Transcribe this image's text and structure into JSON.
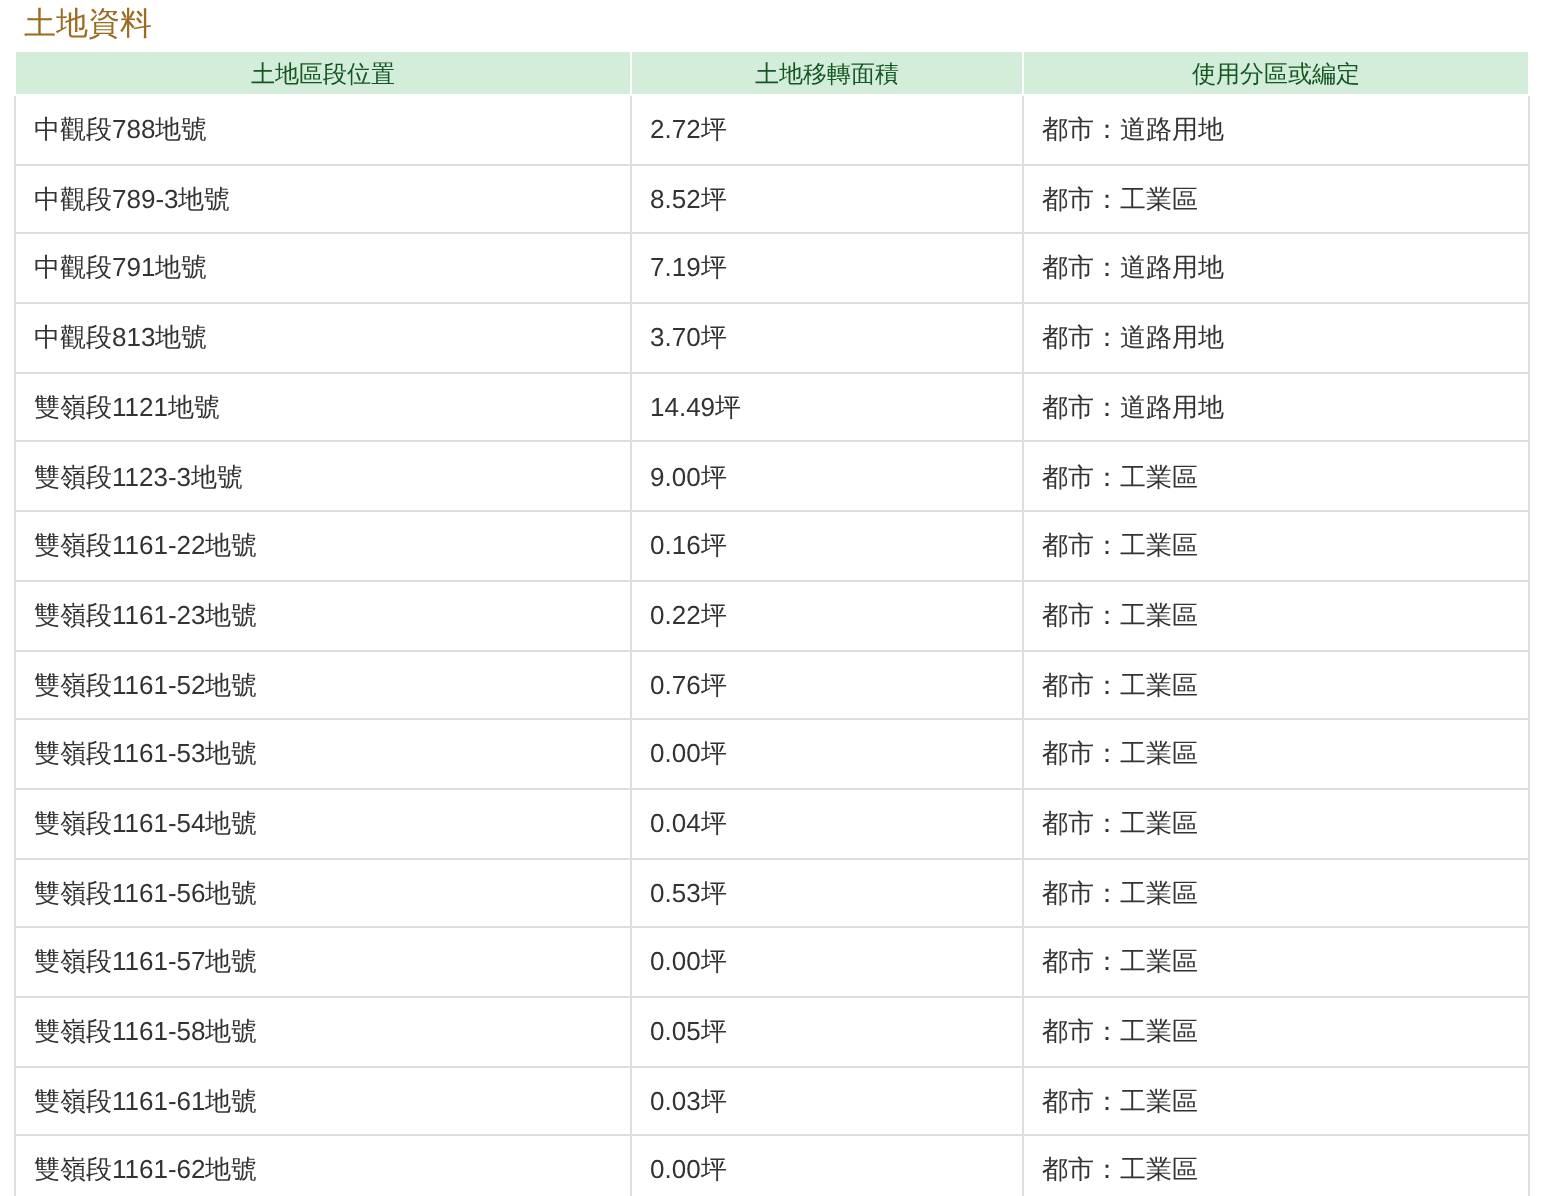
{
  "title": "土地資料",
  "table": {
    "columns": [
      "土地區段位置",
      "土地移轉面積",
      "使用分區或編定"
    ],
    "rows": [
      [
        "中觀段788地號",
        "2.72坪",
        "都市：道路用地"
      ],
      [
        "中觀段789-3地號",
        "8.52坪",
        "都市：工業區"
      ],
      [
        "中觀段791地號",
        "7.19坪",
        "都市：道路用地"
      ],
      [
        "中觀段813地號",
        "3.70坪",
        "都市：道路用地"
      ],
      [
        "雙嶺段1121地號",
        "14.49坪",
        "都市：道路用地"
      ],
      [
        "雙嶺段1123-3地號",
        "9.00坪",
        "都市：工業區"
      ],
      [
        "雙嶺段1161-22地號",
        "0.16坪",
        "都市：工業區"
      ],
      [
        "雙嶺段1161-23地號",
        "0.22坪",
        "都市：工業區"
      ],
      [
        "雙嶺段1161-52地號",
        "0.76坪",
        "都市：工業區"
      ],
      [
        "雙嶺段1161-53地號",
        "0.00坪",
        "都市：工業區"
      ],
      [
        "雙嶺段1161-54地號",
        "0.04坪",
        "都市：工業區"
      ],
      [
        "雙嶺段1161-56地號",
        "0.53坪",
        "都市：工業區"
      ],
      [
        "雙嶺段1161-57地號",
        "0.00坪",
        "都市：工業區"
      ],
      [
        "雙嶺段1161-58地號",
        "0.05坪",
        "都市：工業區"
      ],
      [
        "雙嶺段1161-61地號",
        "0.03坪",
        "都市：工業區"
      ],
      [
        "雙嶺段1161-62地號",
        "0.00坪",
        "都市：工業區"
      ]
    ]
  }
}
